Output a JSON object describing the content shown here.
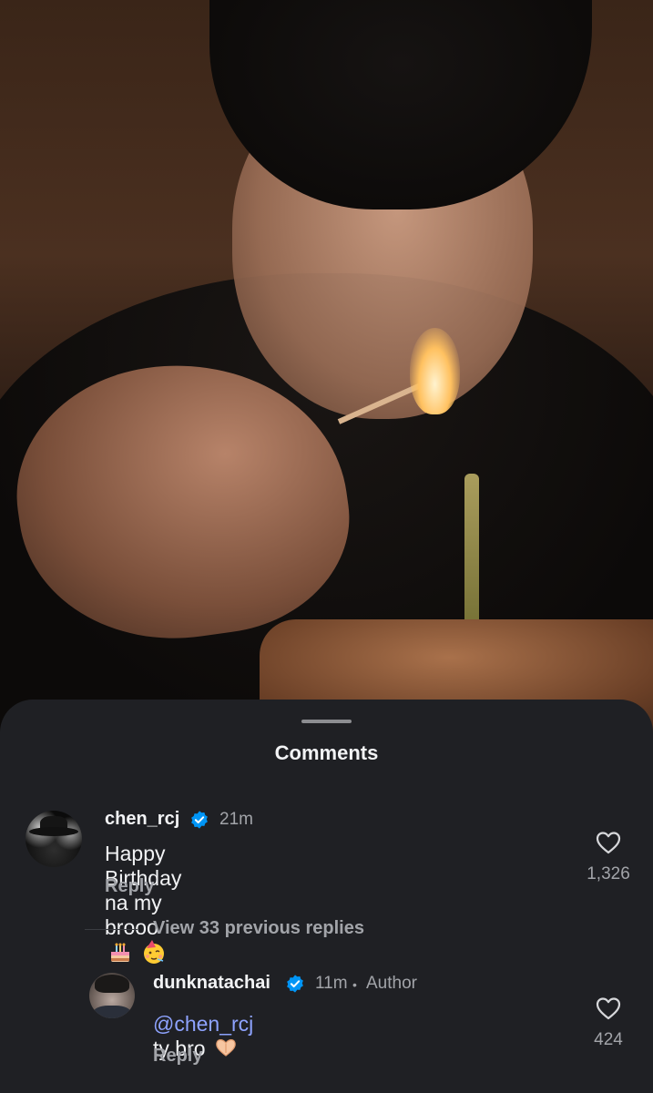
{
  "sheet": {
    "title": "Comments"
  },
  "comments": [
    {
      "username": "chen_rcj",
      "time": "21m",
      "text": "Happy Birthday na my brooo",
      "reply_label": "Reply",
      "likes": "1,326",
      "verified": true
    }
  ],
  "replies_toggle": {
    "label": "View 33 previous replies"
  },
  "replies": [
    {
      "username": "dunknatachai",
      "time": "11m",
      "dot": "•",
      "badge": "Author",
      "mention": "@chen_rcj",
      "text": " ty bro",
      "reply_label": "Reply",
      "likes": "424",
      "verified": true
    }
  ],
  "colors": {
    "sheet_bg": "#1f2024",
    "verified_blue": "#0095f6",
    "mention_blue": "#8ea3ff",
    "muted_text": "#a2a4a9"
  }
}
